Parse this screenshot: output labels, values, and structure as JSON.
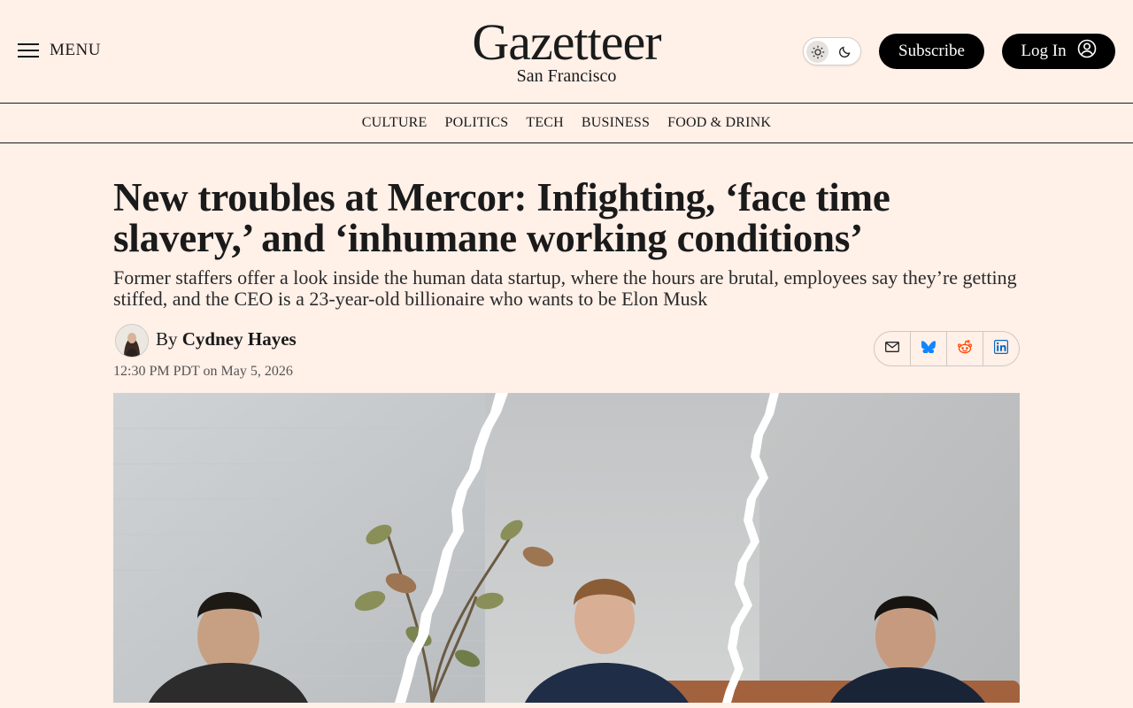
{
  "header": {
    "menu_label": "MENU",
    "logo_title": "Gazetteer",
    "logo_subtitle": "San Francisco",
    "subscribe_label": "Subscribe",
    "login_label": "Log In",
    "icons": [
      "menu-icon",
      "sun-icon",
      "moon-icon",
      "user-icon"
    ]
  },
  "nav": {
    "items": [
      "CULTURE",
      "POLITICS",
      "TECH",
      "BUSINESS",
      "FOOD & DRINK"
    ]
  },
  "article": {
    "headline": "New troubles at Mercor: Infighting, ‘face time slavery,’ and ‘inhumane working conditions’",
    "dek": "Former staffers offer a look inside the human data startup, where the hours are brutal, employees say they’re getting stiffed, and the CEO is a 23-year-old billionaire who wants to be Elon Musk",
    "byline_prefix": "By",
    "author": "Cydney Hayes",
    "dateline": "12:30 PM PDT on May 5, 2026",
    "share_icons": [
      "mail-icon",
      "bluesky-icon",
      "reddit-icon",
      "linkedin-icon"
    ]
  },
  "colors": {
    "background": "#fff0e8",
    "text": "#1a1a1a",
    "button_bg": "#000000",
    "bluesky": "#1185fe",
    "reddit": "#ff4500",
    "linkedin": "#0a66c2"
  }
}
